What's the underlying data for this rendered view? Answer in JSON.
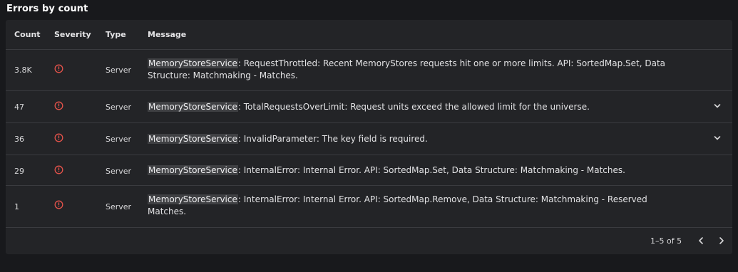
{
  "title": "Errors by count",
  "columns": {
    "count": "Count",
    "severity": "Severity",
    "type": "Type",
    "message": "Message"
  },
  "rows": [
    {
      "count": "3.8K",
      "severity_icon": "error-circle-icon",
      "type": "Server",
      "service": "MemoryStoreService",
      "message_line1": ": RequestThrottled: Recent MemoryStores requests hit one or more limits. API: SortedMap.Set, Data",
      "message_line2": "Structure: Matchmaking - Matches.",
      "expandable": false
    },
    {
      "count": "47",
      "severity_icon": "error-circle-icon",
      "type": "Server",
      "service": "MemoryStoreService",
      "message_line1": ": TotalRequestsOverLimit: Request units exceed the allowed limit for the universe.",
      "message_line2": "",
      "expandable": true
    },
    {
      "count": "36",
      "severity_icon": "error-circle-icon",
      "type": "Server",
      "service": "MemoryStoreService",
      "message_line1": ": InvalidParameter: The key field is required.",
      "message_line2": "",
      "expandable": true
    },
    {
      "count": "29",
      "severity_icon": "error-circle-icon",
      "type": "Server",
      "service": "MemoryStoreService",
      "message_line1": ": InternalError: Internal Error. API: SortedMap.Set, Data Structure: Matchmaking - Matches.",
      "message_line2": "",
      "expandable": false
    },
    {
      "count": "1",
      "severity_icon": "error-circle-icon",
      "type": "Server",
      "service": "MemoryStoreService",
      "message_line1": ": InternalError: Internal Error. API: SortedMap.Remove, Data Structure: Matchmaking - Reserved",
      "message_line2": "Matches.",
      "expandable": false
    }
  ],
  "pagination": {
    "label": "1–5 of 5",
    "prev_icon": "chevron-left-icon",
    "next_icon": "chevron-right-icon"
  },
  "colors": {
    "error": "#e5534b",
    "background": "#18191c",
    "card": "#232427"
  }
}
